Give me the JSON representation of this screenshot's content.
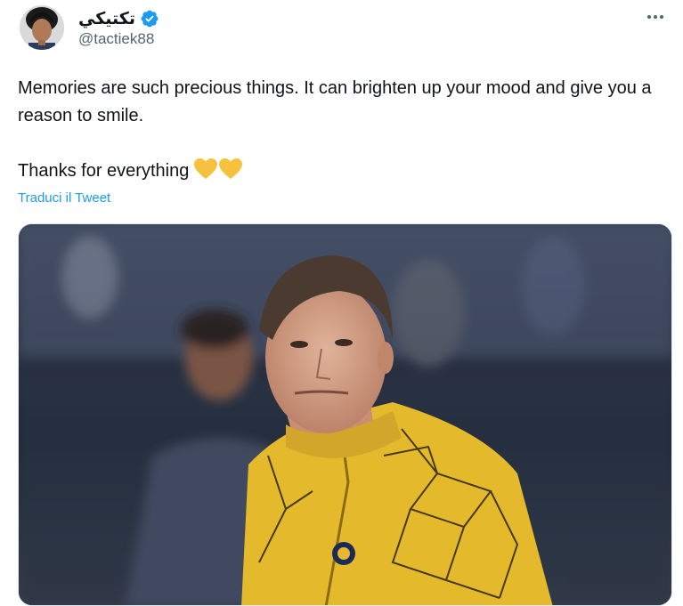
{
  "author": {
    "display_name": "تكتيكي",
    "handle": "@tactiek88",
    "verified": true,
    "avatar_icon": "avatar-photo"
  },
  "menu": {
    "icon": "more-horizontal-icon"
  },
  "tweet": {
    "line1": "Memories are such precious things. It can brighten up your mood and give you a reason to smile.",
    "line2": "Thanks for everything",
    "emoji": [
      "yellow-heart",
      "yellow-heart"
    ]
  },
  "translate_label": "Traduci il Tweet",
  "media": {
    "icon": "tweet-photo"
  },
  "colors": {
    "accent": "#1d9bf0",
    "text": "#0f1419",
    "muted": "#536471",
    "heart": "#f6c23e",
    "jersey": "#e4b92c"
  }
}
